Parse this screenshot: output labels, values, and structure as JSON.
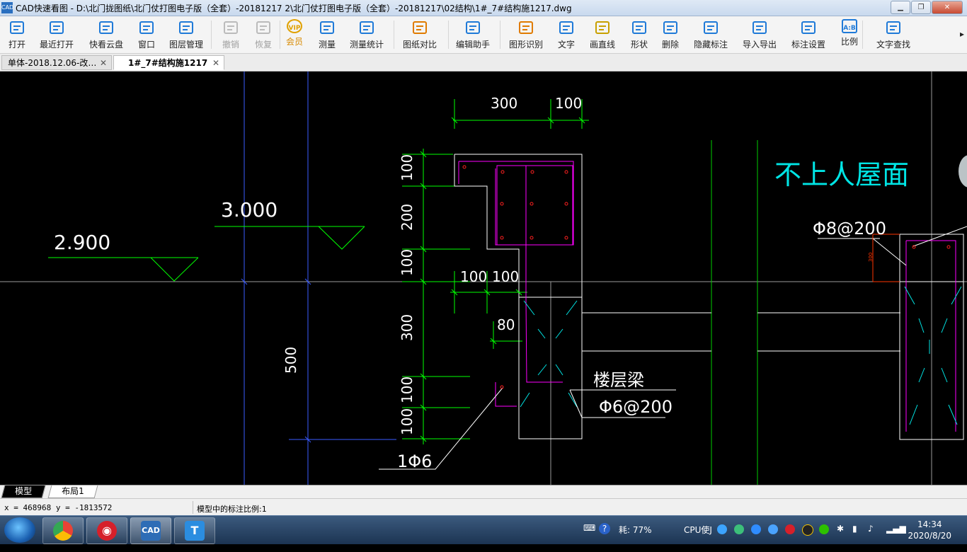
{
  "window": {
    "app_icon": "CAD",
    "title": "CAD快速看图 - D:\\北门拢图纸\\北门仗打图电子版（全套）-20181217 2\\北门仗打图电子版（全套）-20181217\\02结构\\1#_7#结构施1217.dwg",
    "controls": [
      "minimize",
      "restore",
      "close"
    ]
  },
  "toolbar": {
    "items": [
      {
        "id": "open",
        "label": "打开",
        "icon": "folder-icon"
      },
      {
        "id": "recent",
        "label": "最近打开",
        "icon": "clock-icon"
      },
      {
        "id": "cloud",
        "label": "快看云盘",
        "icon": "cloud-icon"
      },
      {
        "id": "window",
        "label": "窗口",
        "icon": "window-icon"
      },
      {
        "id": "layers",
        "label": "图层管理",
        "icon": "layers-icon"
      },
      {
        "id": "undo",
        "label": "撤销",
        "icon": "undo-icon",
        "disabled": true
      },
      {
        "id": "redo",
        "label": "恢复",
        "icon": "redo-icon",
        "disabled": true
      },
      {
        "id": "vip",
        "label": "会员",
        "icon": "vip-icon",
        "badge": "VIP"
      },
      {
        "id": "measure",
        "label": "测量",
        "icon": "ruler-icon"
      },
      {
        "id": "measure_stats",
        "label": "测量统计",
        "icon": "measure-stats-icon"
      },
      {
        "id": "compare",
        "label": "图纸对比",
        "icon": "compare-icon"
      },
      {
        "id": "edit_helper",
        "label": "编辑助手",
        "icon": "edit-helper-icon"
      },
      {
        "id": "recognize",
        "label": "图形识别",
        "icon": "shape-recognize-icon"
      },
      {
        "id": "text",
        "label": "文字",
        "icon": "text-icon"
      },
      {
        "id": "line",
        "label": "画直线",
        "icon": "line-icon"
      },
      {
        "id": "shape",
        "label": "形状",
        "icon": "shape-icon"
      },
      {
        "id": "delete",
        "label": "删除",
        "icon": "eraser-icon"
      },
      {
        "id": "hide_dim",
        "label": "隐藏标注",
        "icon": "eye-hidden-icon"
      },
      {
        "id": "import_export",
        "label": "导入导出",
        "icon": "export-icon"
      },
      {
        "id": "dim_settings",
        "label": "标注设置",
        "icon": "dim-settings-icon"
      },
      {
        "id": "scale",
        "label": "比例",
        "icon": "scale-icon",
        "badge": "A:B"
      },
      {
        "id": "find_text",
        "label": "文字查找",
        "icon": "find-text-icon"
      }
    ],
    "more": "▸"
  },
  "tabs": [
    {
      "label": "单体-2018.12.06-改…",
      "close": "✕",
      "active": false
    },
    {
      "label": "1#_7#结构施1217",
      "close": "✕",
      "active": true
    }
  ],
  "drawing": {
    "labels": {
      "dim_300_top": "300",
      "dim_100_top": "100",
      "dim_100_a": "100",
      "dim_200": "200",
      "dim_100_b": "100",
      "dim_300_mid": "300",
      "dim_100_c": "100",
      "dim_100_d": "100",
      "dim_500": "500",
      "dim_100_h1": "100",
      "dim_100_h2": "100",
      "dim_80": "80",
      "elev_3000": "3.000",
      "elev_2900": "2.900",
      "roof_note": "不上人屋面",
      "rebar_8_200": "Φ8@200",
      "beam_label": "楼层梁",
      "rebar_6_200": "Φ6@200",
      "rebar_1_6": "1Φ6",
      "small_red": "300"
    },
    "colors": {
      "background": "#000000",
      "dim": "#00ff00",
      "text": "#ffffff",
      "outline": "#ffffff",
      "rebar": "#ff00ff",
      "rebar_dot": "#ff2020",
      "axis": "#3a5cff",
      "cyan": "#00e5e5",
      "red_dim": "#ff3300"
    }
  },
  "sheet_tabs": [
    {
      "label": "模型",
      "active": true
    },
    {
      "label": "布局1",
      "active": false
    }
  ],
  "status": {
    "coords": "x = 468968  y = -1813572",
    "scale": "模型中的标注比例:1"
  },
  "taskbar": {
    "apps": [
      {
        "name": "browser-app",
        "icon": "chrome-like-icon"
      },
      {
        "name": "netease-music-app",
        "icon": "music-icon"
      },
      {
        "name": "cad-app",
        "icon": "cad-icon",
        "label": "CAD"
      },
      {
        "name": "text-app",
        "icon": "text-app-icon",
        "label": "T"
      }
    ],
    "tray": {
      "ime": "⌨",
      "help": "?",
      "battery": "耗: 77%",
      "cpu": "CPU使J",
      "time": "14:34",
      "date": "2020/8/20"
    }
  }
}
